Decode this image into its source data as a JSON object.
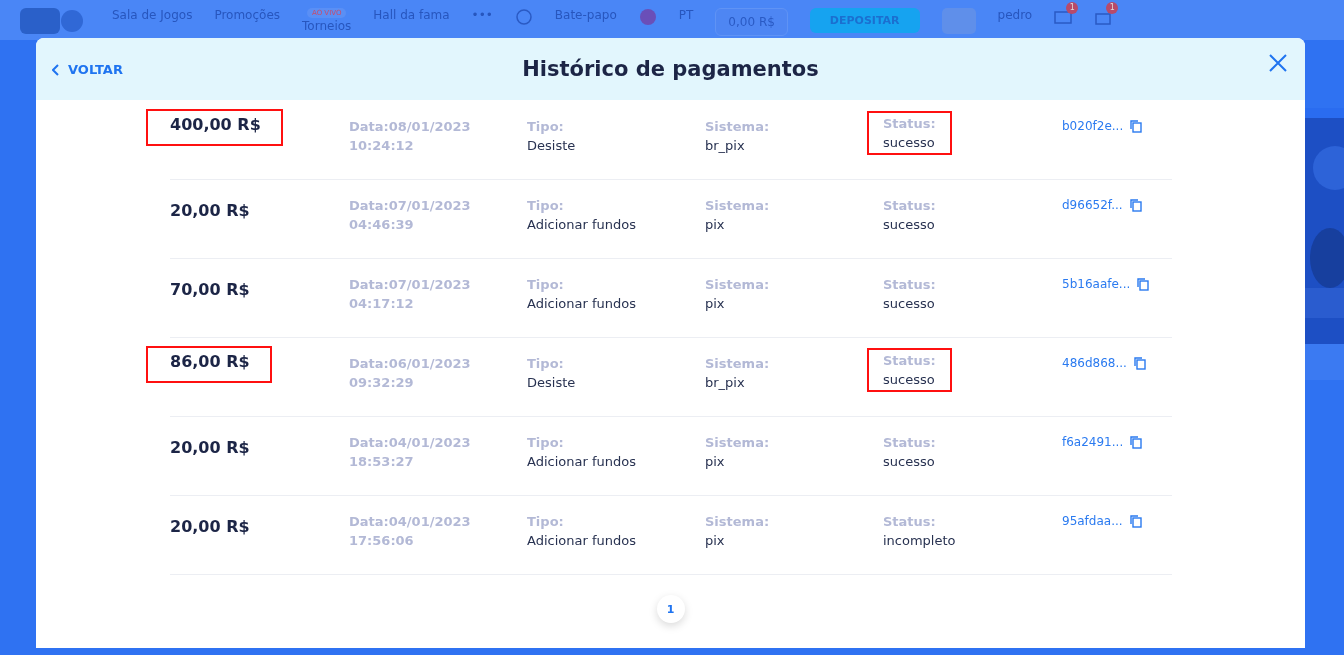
{
  "site_header": {
    "nav": [
      {
        "label": "Sala de Jogos"
      },
      {
        "label": "Promoções"
      },
      {
        "label": "Torneios",
        "badge": "AO VIVO"
      },
      {
        "label": "Hall da fama"
      }
    ],
    "more": "•••",
    "chat": "Bate-papo",
    "language": "PT",
    "balance": "0,00 R$",
    "deposit": "DEPOSITAR",
    "user": "pedro",
    "mail_count": "1",
    "gift_count": "1"
  },
  "modal": {
    "back": "VOLTAR",
    "title": "Histórico de pagamentos",
    "rows": [
      {
        "amount": "400,00 R$",
        "amount_marked": true,
        "date": "Data:08/01/2023",
        "time": "10:24:12",
        "type_label": "Tipo:",
        "type": "Desiste",
        "system_label": "Sistema:",
        "system": "br_pix",
        "status_label": "Status:",
        "status": "sucesso",
        "status_marked": true,
        "id": "b020f2e..."
      },
      {
        "amount": "20,00 R$",
        "amount_marked": false,
        "date": "Data:07/01/2023",
        "time": "04:46:39",
        "type_label": "Tipo:",
        "type": "Adicionar fundos",
        "system_label": "Sistema:",
        "system": "pix",
        "status_label": "Status:",
        "status": "sucesso",
        "status_marked": false,
        "id": "d96652f..."
      },
      {
        "amount": "70,00 R$",
        "amount_marked": false,
        "date": "Data:07/01/2023",
        "time": "04:17:12",
        "type_label": "Tipo:",
        "type": "Adicionar fundos",
        "system_label": "Sistema:",
        "system": "pix",
        "status_label": "Status:",
        "status": "sucesso",
        "status_marked": false,
        "id": "5b16aafe..."
      },
      {
        "amount": "86,00 R$",
        "amount_marked": true,
        "date": "Data:06/01/2023",
        "time": "09:32:29",
        "type_label": "Tipo:",
        "type": "Desiste",
        "system_label": "Sistema:",
        "system": "br_pix",
        "status_label": "Status:",
        "status": "sucesso",
        "status_marked": true,
        "id": "486d868..."
      },
      {
        "amount": "20,00 R$",
        "amount_marked": false,
        "date": "Data:04/01/2023",
        "time": "18:53:27",
        "type_label": "Tipo:",
        "type": "Adicionar fundos",
        "system_label": "Sistema:",
        "system": "pix",
        "status_label": "Status:",
        "status": "sucesso",
        "status_marked": false,
        "id": "f6a2491..."
      },
      {
        "amount": "20,00 R$",
        "amount_marked": false,
        "date": "Data:04/01/2023",
        "time": "17:56:06",
        "type_label": "Tipo:",
        "type": "Adicionar fundos",
        "system_label": "Sistema:",
        "system": "pix",
        "status_label": "Status:",
        "status": "incompleto",
        "status_marked": false,
        "id": "95afdaa..."
      }
    ],
    "pages": [
      {
        "label": "1",
        "selected": true
      }
    ]
  }
}
